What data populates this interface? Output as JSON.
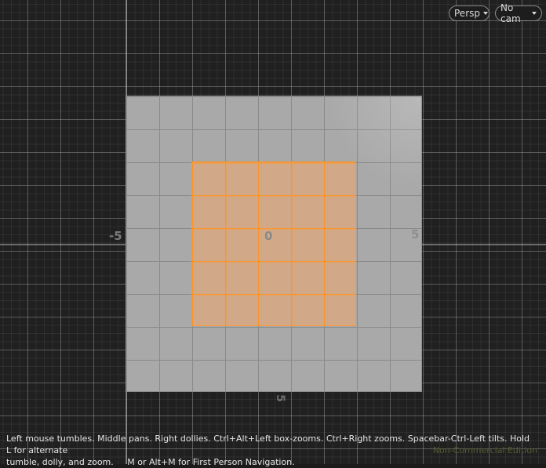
{
  "viewport": {
    "view_menu": "Persp",
    "camera_menu": "No cam",
    "axis_labels": {
      "x_neg": "-5",
      "origin": "0",
      "x_pos": "5",
      "z_pos": "5"
    },
    "help_line1": "Left mouse tumbles. Middle pans. Right dollies. Ctrl+Alt+Left box-zooms. Ctrl+Right zooms. Spacebar-Ctrl-Left tilts. Hold L for alternate",
    "help_line2": "tumble, dolly, and zoom.     M or Alt+M for First Person Navigation.",
    "edition": "Non-Commercial Edition"
  },
  "colors": {
    "background": "#202020",
    "ground_plane": "#a9a9a9",
    "selection_fill": "#f2aa6e",
    "selection_edges": "#ff9628",
    "edition_text": "#565c2f"
  },
  "icons": {
    "dropdown": "chevron-down-icon"
  }
}
